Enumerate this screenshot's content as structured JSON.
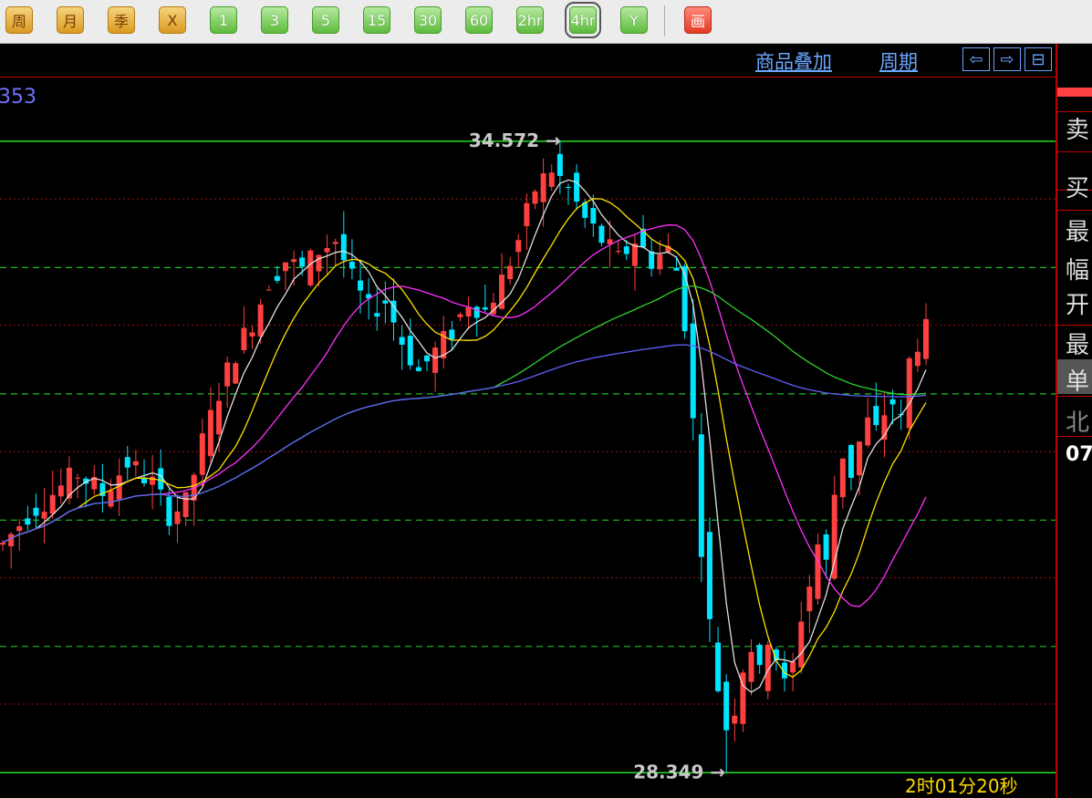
{
  "toolbar": {
    "buttons": [
      {
        "label": "周",
        "style": "gold"
      },
      {
        "label": "月",
        "style": "gold"
      },
      {
        "label": "季",
        "style": "gold"
      },
      {
        "label": "X",
        "style": "gold"
      },
      {
        "label": "1",
        "style": "green"
      },
      {
        "label": "3",
        "style": "green"
      },
      {
        "label": "5",
        "style": "green"
      },
      {
        "label": "15",
        "style": "green"
      },
      {
        "label": "30",
        "style": "green"
      },
      {
        "label": "60",
        "style": "green"
      },
      {
        "label": "2hr",
        "style": "green"
      },
      {
        "label": "4hr",
        "style": "green",
        "selected": true
      },
      {
        "label": "Y",
        "style": "green"
      },
      {
        "label": "画",
        "style": "red"
      }
    ]
  },
  "topbar": {
    "overlay_label": "商品叠加",
    "period_label": "周期",
    "nav_icons": [
      "arrow-left-icon",
      "arrow-right-icon",
      "layout-icon"
    ]
  },
  "left_value": "353",
  "right_panel": {
    "items": [
      "卖",
      "买",
      "最",
      "幅",
      "开",
      "最",
      "单",
      "北",
      "07"
    ]
  },
  "timer": "2时01分20秒",
  "colors": {
    "up": "#ff4040",
    "down": "#00e5ff",
    "ma5": "#e0e0e0",
    "ma10": "#ffe000",
    "ma20": "#ff30ff",
    "ma60": "#30d030",
    "ma120": "#6060ff"
  },
  "chart_data": {
    "type": "candlestick",
    "price_high_label": "34.572",
    "price_low_label": "28.349",
    "ylim": [
      28.1,
      35.2
    ],
    "grid": "horizontal dashed",
    "close_path": [
      [
        0,
        30.6
      ],
      [
        3,
        30.9
      ],
      [
        6,
        31.1
      ],
      [
        9,
        31.3
      ],
      [
        12,
        31.1
      ],
      [
        15,
        31.4
      ],
      [
        18,
        31.2
      ],
      [
        20,
        30.9
      ],
      [
        22,
        31.0
      ],
      [
        24,
        31.6
      ],
      [
        26,
        32.1
      ],
      [
        28,
        32.5
      ],
      [
        30,
        32.8
      ],
      [
        32,
        33.2
      ],
      [
        34,
        33.4
      ],
      [
        36,
        33.3
      ],
      [
        38,
        33.5
      ],
      [
        40,
        33.6
      ],
      [
        42,
        33.2
      ],
      [
        44,
        32.9
      ],
      [
        46,
        33.0
      ],
      [
        48,
        32.6
      ],
      [
        50,
        32.3
      ],
      [
        52,
        32.5
      ],
      [
        54,
        32.7
      ],
      [
        56,
        33.0
      ],
      [
        58,
        32.9
      ],
      [
        60,
        33.2
      ],
      [
        62,
        33.6
      ],
      [
        64,
        34.1
      ],
      [
        66,
        34.3
      ],
      [
        68,
        34.1
      ],
      [
        70,
        33.8
      ],
      [
        72,
        33.6
      ],
      [
        74,
        33.4
      ],
      [
        76,
        33.6
      ],
      [
        78,
        33.4
      ],
      [
        80,
        33.5
      ],
      [
        81,
        33.3
      ],
      [
        82,
        32.8
      ],
      [
        83,
        31.8
      ],
      [
        84,
        30.6
      ],
      [
        85,
        29.8
      ],
      [
        86,
        29.2
      ],
      [
        87,
        28.8
      ],
      [
        88,
        29.0
      ],
      [
        89,
        29.4
      ],
      [
        90,
        29.6
      ],
      [
        91,
        29.3
      ],
      [
        92,
        29.7
      ],
      [
        93,
        29.5
      ],
      [
        94,
        29.2
      ],
      [
        95,
        29.4
      ],
      [
        96,
        29.9
      ],
      [
        97,
        30.2
      ],
      [
        98,
        30.6
      ],
      [
        99,
        30.4
      ],
      [
        100,
        31.1
      ],
      [
        101,
        31.5
      ],
      [
        102,
        31.3
      ],
      [
        103,
        31.6
      ],
      [
        104,
        31.8
      ],
      [
        105,
        31.7
      ],
      [
        106,
        31.9
      ],
      [
        107,
        32.0
      ],
      [
        108,
        31.8
      ],
      [
        109,
        32.4
      ],
      [
        110,
        32.6
      ],
      [
        111,
        32.7
      ]
    ],
    "n_bars": 112,
    "moving_averages": [
      {
        "name": "MA5",
        "window": 5
      },
      {
        "name": "MA10",
        "window": 10
      },
      {
        "name": "MA20",
        "window": 20
      },
      {
        "name": "MA60",
        "window": 60
      },
      {
        "name": "MA120",
        "window": 120
      }
    ]
  }
}
